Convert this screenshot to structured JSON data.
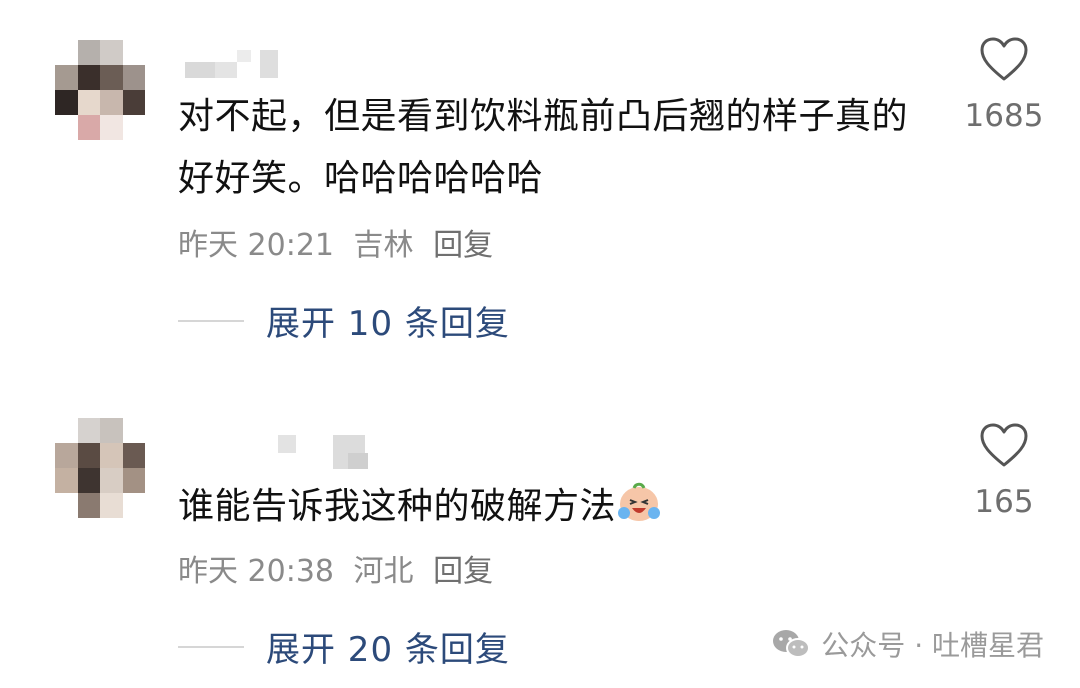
{
  "comments": [
    {
      "text": "对不起，但是看到饮料瓶前凸后翘的样子真的好好笑。哈哈哈哈哈哈",
      "time": "昨天 20:21",
      "location": "吉林",
      "reply_label": "回复",
      "likes": "1685",
      "expand_label": "展开 10 条回复"
    },
    {
      "text": "谁能告诉我这种的破解方法",
      "emoji": "crying-laughing-emoji",
      "time": "昨天 20:38",
      "location": "河北",
      "reply_label": "回复",
      "likes": "165",
      "expand_label": "展开 20 条回复"
    }
  ],
  "watermark": {
    "text": "公众号 · 吐槽星君",
    "icon": "wechat-icon"
  },
  "colors": {
    "expand_link": "#2c4a7a",
    "meta_gray": "#8a8a8a",
    "like_gray": "#6e6e6e"
  }
}
